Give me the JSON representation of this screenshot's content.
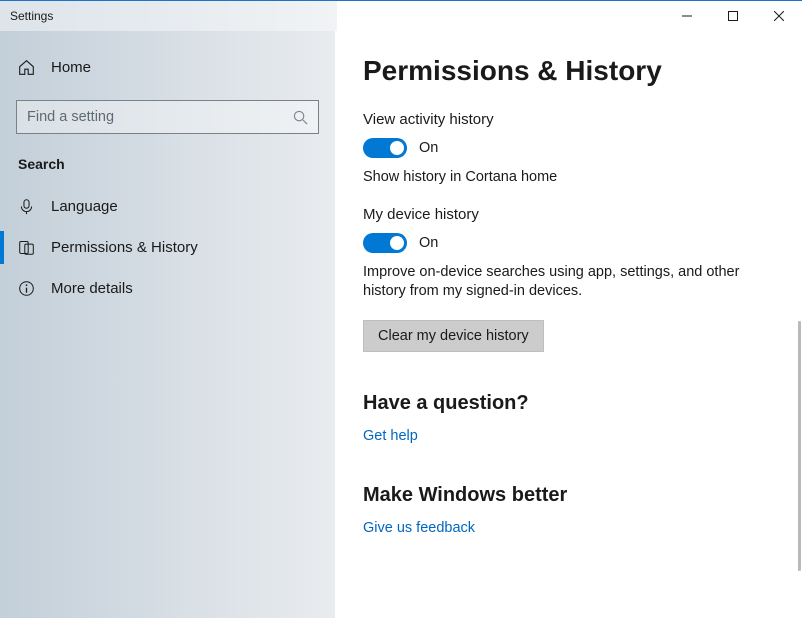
{
  "app_title": "Settings",
  "sidebar": {
    "home_label": "Home",
    "search_placeholder": "Find a setting",
    "section_label": "Search",
    "items": [
      {
        "label": "Language"
      },
      {
        "label": "Permissions & History"
      },
      {
        "label": "More details"
      }
    ]
  },
  "page": {
    "title": "Permissions & History",
    "view_activity": {
      "label": "View activity history",
      "state": "On",
      "desc": "Show history in Cortana home"
    },
    "device_history": {
      "label": "My device history",
      "state": "On",
      "desc": "Improve on-device searches using app, settings, and other history from my signed-in devices.",
      "clear_button": "Clear my device history"
    },
    "question": {
      "heading": "Have a question?",
      "link": "Get help"
    },
    "feedback": {
      "heading": "Make Windows better",
      "link": "Give us feedback"
    }
  }
}
